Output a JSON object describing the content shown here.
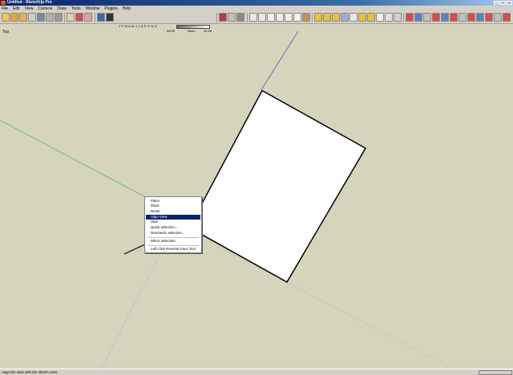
{
  "window": {
    "title": "Untitled - SketchUp Pro",
    "buttons": [
      "minimize",
      "maximize",
      "close"
    ]
  },
  "menu": [
    "File",
    "Edit",
    "View",
    "Camera",
    "Draw",
    "Tools",
    "Window",
    "Plugins",
    "Help"
  ],
  "shadow_settings": {
    "months": "J F M A M J J A S O N D",
    "time_start": "06:35",
    "time_mid": "Noon",
    "time_end": "04:35"
  },
  "toolbar_icons": [
    "select-icon",
    "component-icon",
    "paint-bucket-icon",
    "eraser-icon",
    "rectangle-icon",
    "line-icon",
    "circle-icon",
    "arc-icon",
    "polygon-icon",
    "freehand-icon",
    "move-icon",
    "push-pull-icon",
    "rotate-icon",
    "follow-me-icon",
    "scale-icon",
    "offset-icon",
    "tape-measure-icon",
    "dimension-icon",
    "protractor-icon",
    "text-icon",
    "axes-icon",
    "3d-text-icon",
    "orbit-icon",
    "pan-icon",
    "zoom-icon",
    "zoom-window-icon",
    "zoom-extents-icon",
    "iso-view-icon",
    "top-view-icon",
    "front-view-icon",
    "right-view-icon",
    "back-view-icon",
    "left-view-icon",
    "xray-icon",
    "wireframe-icon",
    "hidden-line-icon",
    "shaded-icon",
    "textured-icon",
    "monochrome-icon",
    "sandbox-icon",
    "smoove-icon",
    "stamp-icon",
    "drape-icon",
    "add-detail-icon",
    "flip-edge-icon"
  ],
  "view_label": "Top",
  "context_menu": {
    "items": [
      "Place",
      "Move",
      "Reset",
      "Align View",
      "Hide",
      "Quick selection...",
      "Geometric selection...",
      "Mirror Selection",
      "Left Click Reverse Face Tool"
    ],
    "active_item": "Align View"
  },
  "status_bar": {
    "text": "Align the view with the sketch axes"
  },
  "colors": {
    "canvas": "#d6d4bd",
    "titlebar": "#0a246a",
    "highlight": "#0a246a",
    "green_axis": "#3fb83f",
    "blue_axis": "#3a3aa0"
  }
}
